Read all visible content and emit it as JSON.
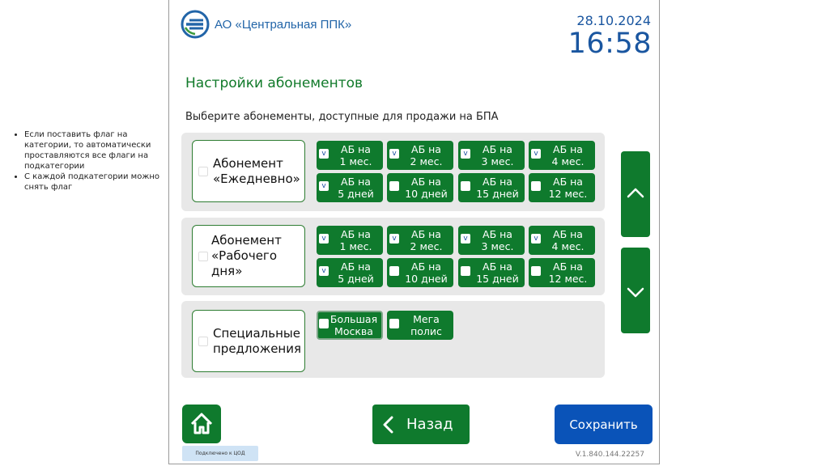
{
  "notes": [
    "Если поставить флаг на категории, то автоматически проставляются все флаги на подкатегории",
    "С каждой подкатегории можно снять флаг"
  ],
  "header": {
    "company": "АО «Центральная ППК»",
    "date": "28.10.2024",
    "time": "16:58"
  },
  "page_title": "Настройки абонементов",
  "subtitle": "Выберите абонементы, доступные для продажи на БПА",
  "categories": [
    {
      "label_line1": "Абонемент",
      "label_line2": "«Ежедневно»",
      "checked": false,
      "options": [
        {
          "line1": "АБ на",
          "line2": "1 мес.",
          "checked": true,
          "mark": "v"
        },
        {
          "line1": "АБ на",
          "line2": "2 мес.",
          "checked": true,
          "mark": "v"
        },
        {
          "line1": "АБ на",
          "line2": "3 мес.",
          "checked": true,
          "mark": "v"
        },
        {
          "line1": "АБ на",
          "line2": "4 мес.",
          "checked": true,
          "mark": "v"
        },
        {
          "line1": "АБ на",
          "line2": "5 дней",
          "checked": true,
          "mark": "v"
        },
        {
          "line1": "АБ на",
          "line2": "10 дней",
          "checked": false,
          "mark": ""
        },
        {
          "line1": "АБ на",
          "line2": "15 дней",
          "checked": false,
          "mark": ""
        },
        {
          "line1": "АБ на",
          "line2": "12 мес.",
          "checked": false,
          "mark": ""
        }
      ]
    },
    {
      "label_line1": "Абонемент",
      "label_line2": "«Рабочего",
      "label_line3": "дня»",
      "checked": false,
      "options": [
        {
          "line1": "АБ на",
          "line2": "1 мес.",
          "checked": true,
          "mark": "v"
        },
        {
          "line1": "АБ на",
          "line2": "2 мес.",
          "checked": true,
          "mark": "v"
        },
        {
          "line1": "АБ на",
          "line2": "3 мес.",
          "checked": true,
          "mark": "v"
        },
        {
          "line1": "АБ на",
          "line2": "4 мес.",
          "checked": true,
          "mark": "v"
        },
        {
          "line1": "АБ на",
          "line2": "5 дней",
          "checked": true,
          "mark": "v"
        },
        {
          "line1": "АБ на",
          "line2": "10 дней",
          "checked": false,
          "mark": ""
        },
        {
          "line1": "АБ на",
          "line2": "15 дней",
          "checked": false,
          "mark": ""
        },
        {
          "line1": "АБ на",
          "line2": "12 мес.",
          "checked": false,
          "mark": ""
        }
      ]
    },
    {
      "label_line1": "Специальные",
      "label_line2": "предложения",
      "checked": false,
      "options": [
        {
          "line1": "Большая",
          "line2": "Москва",
          "checked": false,
          "mark": ""
        },
        {
          "line1": "Мега",
          "line2": "полис",
          "checked": false,
          "mark": ""
        }
      ]
    }
  ],
  "buttons": {
    "back": "Назад",
    "save": "Сохранить"
  },
  "status": "Подключено к ЦОД",
  "version": "V.1.840.144.22257",
  "icons": {
    "logo": "company-logo-icon",
    "home": "home-icon",
    "scroll_up": "chevron-up-icon",
    "scroll_down": "chevron-down-icon",
    "back": "chevron-left-icon"
  },
  "colors": {
    "primary_green": "#0f7a2d",
    "accent_blue": "#1a56a0",
    "save_blue": "#0a53b8"
  }
}
